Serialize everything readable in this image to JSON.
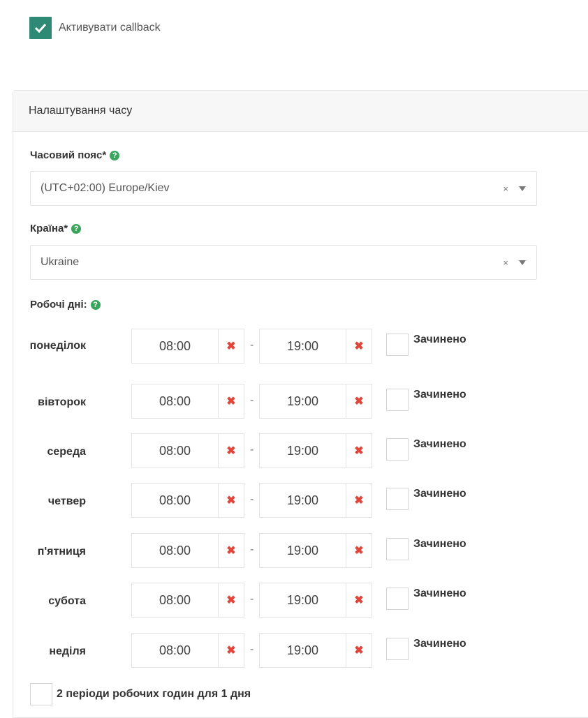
{
  "activate": {
    "label": "Активувати callback",
    "checked": true
  },
  "panel": {
    "title": "Налаштування часу",
    "timezone": {
      "label": "Часовий пояс*",
      "value": "(UTC+02:00) Europe/Kiev",
      "clear": "×"
    },
    "country": {
      "label": "Країна*",
      "value": "Ukraine",
      "clear": "×"
    },
    "working_days": {
      "label": "Робочі дні:",
      "closed_label": "Зачинено",
      "clear_icon": "✖",
      "dash": "-",
      "days": [
        {
          "name": "понеділок",
          "from": "08:00",
          "to": "19:00"
        },
        {
          "name": "вівторок",
          "from": "08:00",
          "to": "19:00"
        },
        {
          "name": "середа",
          "from": "08:00",
          "to": "19:00"
        },
        {
          "name": "четвер",
          "from": "08:00",
          "to": "19:00"
        },
        {
          "name": "п'ятниця",
          "from": "08:00",
          "to": "19:00"
        },
        {
          "name": "субота",
          "from": "08:00",
          "to": "19:00"
        },
        {
          "name": "неділя",
          "from": "08:00",
          "to": "19:00"
        }
      ]
    },
    "two_periods_label": "2 періоди робочих годин для 1 дня",
    "help_icon": "?"
  },
  "colors": {
    "accent": "#2e8a75",
    "help": "#3aa55c",
    "clear": "#e0463a"
  }
}
